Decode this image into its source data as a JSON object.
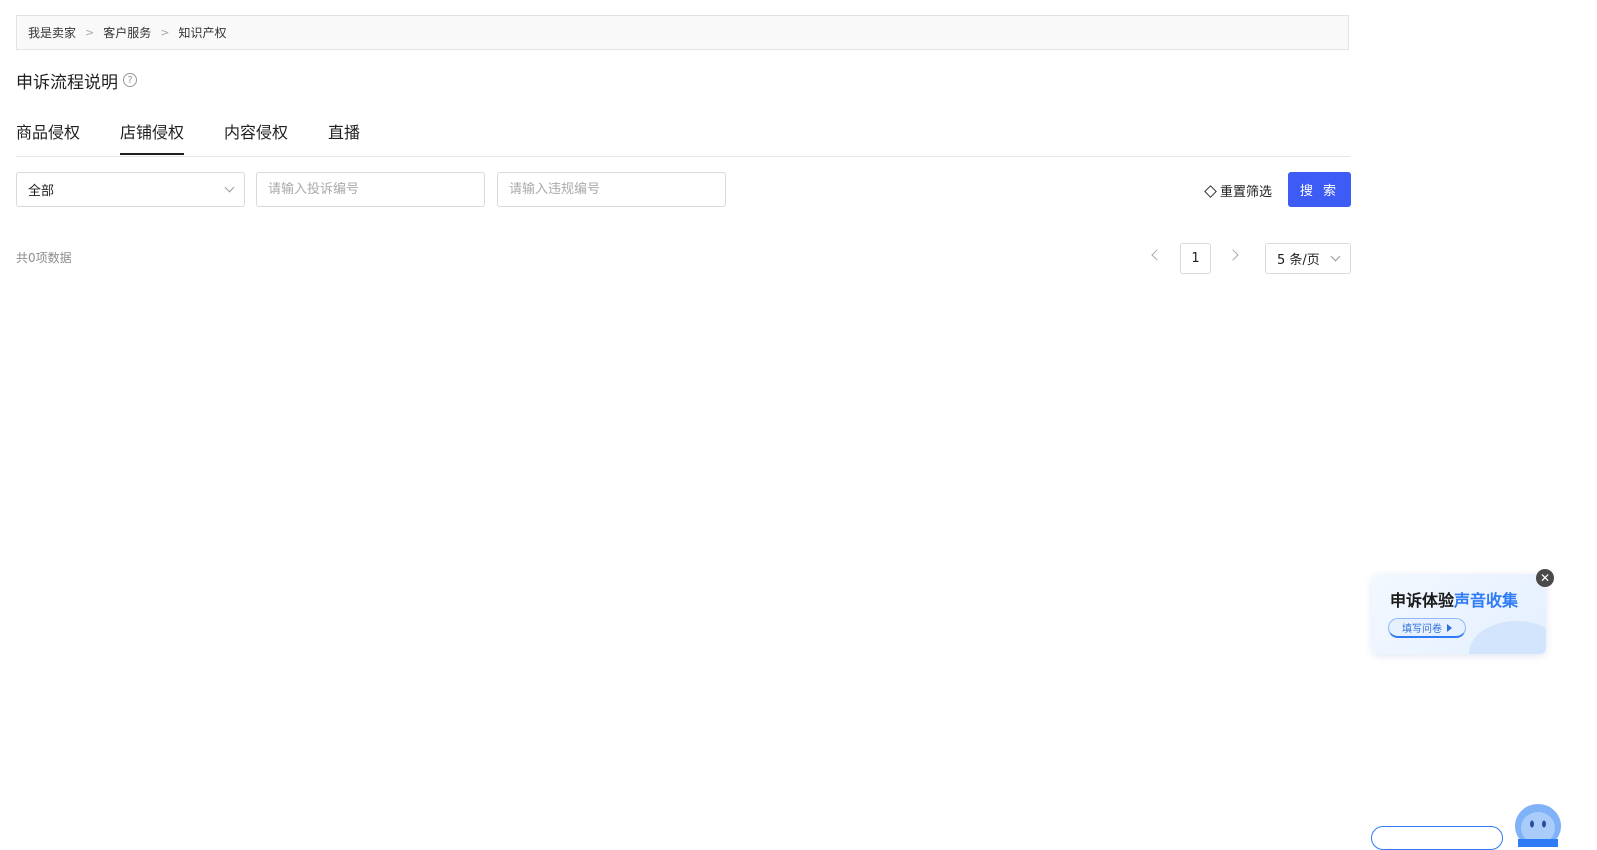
{
  "breadcrumb": {
    "items": [
      "我是卖家",
      "客户服务",
      "知识产权"
    ],
    "separator": ">"
  },
  "page": {
    "title": "申诉流程说明",
    "help_icon": "question-circle-icon"
  },
  "tabs": [
    {
      "label": "商品侵权",
      "active": false
    },
    {
      "label": "店铺侵权",
      "active": true
    },
    {
      "label": "内容侵权",
      "active": false
    },
    {
      "label": "直播",
      "active": false
    }
  ],
  "filters": {
    "status_select": "全部",
    "complaint_no_placeholder": "请输入投诉编号",
    "violation_no_placeholder": "请输入违规编号",
    "reset_label": "重置筛选",
    "search_label": "搜 索"
  },
  "pagination": {
    "total_text": "共0项数据",
    "current_page": "1",
    "page_size": "5 条/页"
  },
  "banner": {
    "title_prefix": "申诉体验",
    "title_highlight": "声音收集",
    "cta_label": "填写问卷"
  },
  "colors": {
    "primary": "#3d5bf5",
    "banner_highlight": "#2f7bf5"
  }
}
